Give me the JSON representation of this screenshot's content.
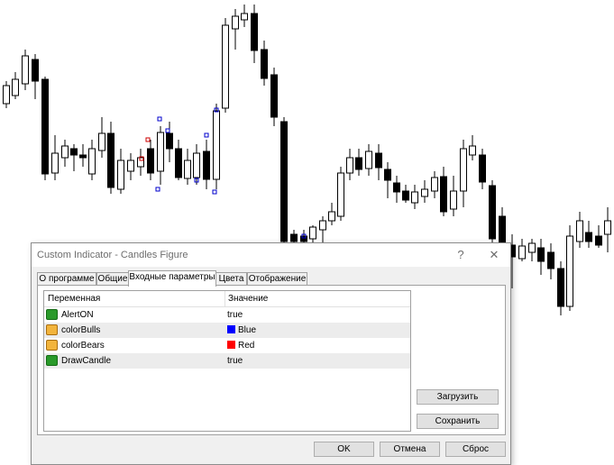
{
  "dialog": {
    "title": "Custom Indicator - Candles Figure",
    "help_label": "?",
    "close_label": "✕"
  },
  "tabs": [
    {
      "label": "О программе"
    },
    {
      "label": "Общие"
    },
    {
      "label": "Входные параметры",
      "active": true
    },
    {
      "label": "Цвета"
    },
    {
      "label": "Отображение"
    }
  ],
  "table": {
    "headers": {
      "variable": "Переменная",
      "value": "Значение"
    },
    "rows": [
      {
        "name": "AlertON",
        "value": "true",
        "icon": "boolean-param-icon"
      },
      {
        "name": "colorBulls",
        "value": "Blue",
        "icon": "color-param-icon",
        "swatch": "#0000ff"
      },
      {
        "name": "colorBears",
        "value": "Red",
        "icon": "color-param-icon",
        "swatch": "#ff0000"
      },
      {
        "name": "DrawCandle",
        "value": "true",
        "icon": "boolean-param-icon"
      }
    ]
  },
  "buttons": {
    "load": "Загрузить",
    "save": "Сохранить",
    "ok": "OK",
    "cancel": "Отмена",
    "reset": "Сброс"
  },
  "colors": {
    "candle_body_bear": "#000000",
    "candle_body_bull": "#ffffff",
    "marker_blue": "#0000cc",
    "marker_red": "#cc0000"
  }
}
